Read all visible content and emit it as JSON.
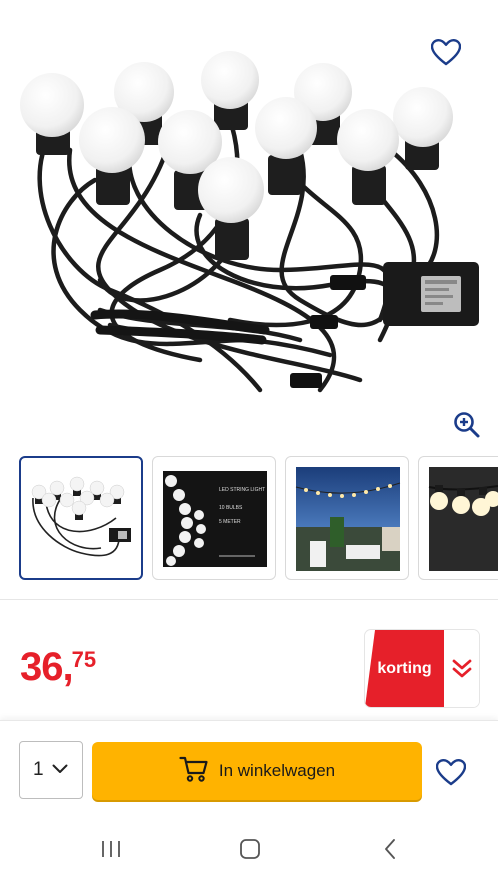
{
  "product": {
    "image_alt": "LED string light with 10 bulbs",
    "thumbnails": [
      {
        "name": "string-light-bulbs"
      },
      {
        "name": "led-string-light-box",
        "lines": [
          "LED STRING LIGHT",
          "10 BULBS",
          "5 METER"
        ]
      },
      {
        "name": "terrace-evening-photo"
      },
      {
        "name": "bulbs-closeup"
      }
    ]
  },
  "price": {
    "euros": "36",
    "comma": ",",
    "cents": "75",
    "color": "#e6202a"
  },
  "korting": {
    "label": "korting",
    "color": "#e6202a"
  },
  "cart": {
    "quantity": "1",
    "button_label": "In winkelwagen",
    "button_color": "#ffb300"
  },
  "icons": {
    "wishlist": "heart-icon",
    "zoom": "zoom-in-icon",
    "cart": "shopping-cart-icon",
    "chevron": "chevron-down-icon",
    "accent": "#1b3c8a"
  }
}
